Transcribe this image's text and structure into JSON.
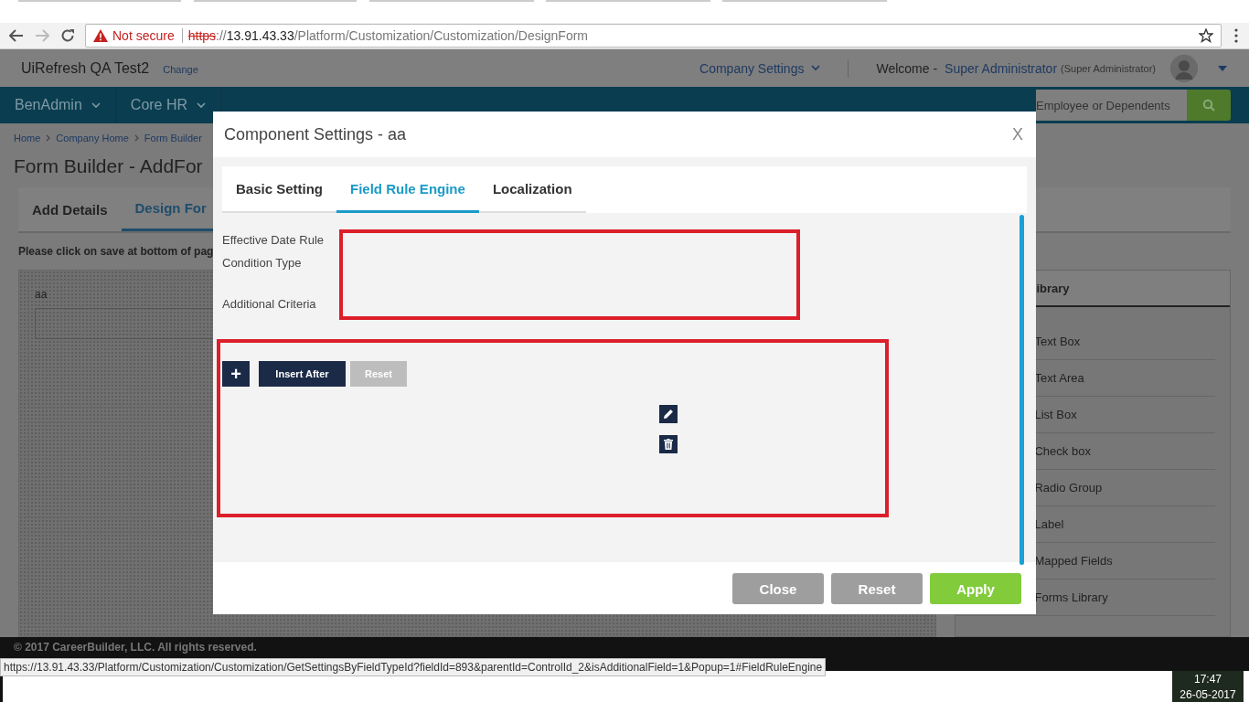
{
  "browser": {
    "security": "Not secure",
    "scheme": "https",
    "separator": "://",
    "host": "13.91.43.33",
    "path": "/Platform/Customization/Customization/DesignForm"
  },
  "header": {
    "company": "UiRefresh QA Test2",
    "change_link": "Change",
    "settings_menu": "Company Settings",
    "welcome": "Welcome -",
    "user": "Super Administrator",
    "role": "(Super Administrator)"
  },
  "nav": {
    "items": [
      "BenAdmin",
      "Core HR"
    ],
    "search_placeholder": "Employee or Dependents"
  },
  "breadcrumb": [
    "Home",
    "Company Home",
    "Form Builder"
  ],
  "page_title": "Form Builder - AddFor",
  "page_tabs": [
    {
      "label": "Add Details",
      "selected": false
    },
    {
      "label": "Design For",
      "selected": true
    }
  ],
  "notice": "Please click on save at bottom of pag",
  "canvas": {
    "field_label": "aa"
  },
  "library": {
    "title": "ibrary",
    "items": [
      "Text Box",
      "Text Area",
      "List Box",
      "Check box",
      "Radio Group",
      "Label",
      "Mapped Fields",
      "Forms Library"
    ]
  },
  "modal": {
    "title": "Component Settings - aa",
    "close": "X",
    "tabs": [
      {
        "label": "Basic Setting",
        "selected": false
      },
      {
        "label": "Field Rule Engine",
        "selected": true
      },
      {
        "label": "Localization",
        "selected": false
      }
    ],
    "labels": [
      "Effective Date Rule",
      "Condition Type",
      "Additional Criteria"
    ],
    "rule_buttons": {
      "add": "+",
      "insert": "Insert After",
      "reset": "Reset"
    },
    "footer_buttons": [
      {
        "label": "Close",
        "kind": "secondary"
      },
      {
        "label": "Reset",
        "kind": "secondary"
      },
      {
        "label": "Apply",
        "kind": "primary"
      }
    ]
  },
  "footer_text": "© 2017 CareerBuilder, LLC. All rights reserved.",
  "status_url": "https://13.91.43.33/Platform/Customization/Customization/GetSettingsByFieldTypeId?fieldId=893&parentId=ControlId_2&isAdditionalField=1&Popup=1#FieldRuleEngine",
  "clock": {
    "time": "17:47",
    "date": "26-05-2017"
  }
}
